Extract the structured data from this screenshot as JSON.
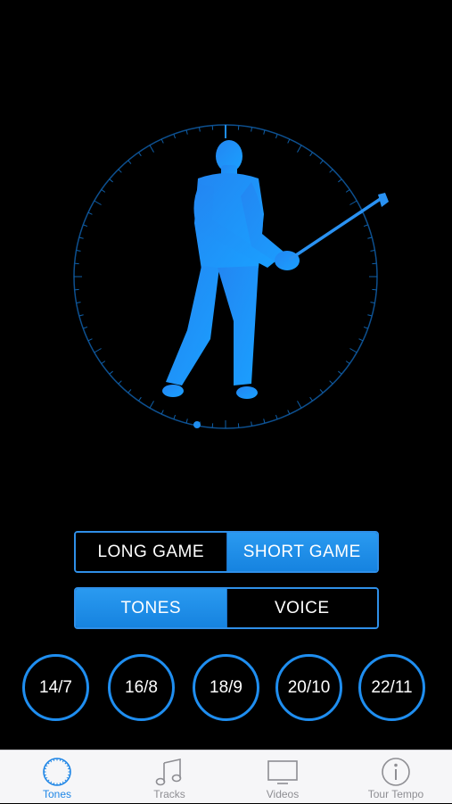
{
  "colors": {
    "accent": "#1f8ef0",
    "background": "#000000",
    "tab_active": "#1f86e6",
    "tab_inactive": "#8e8e93"
  },
  "game_toggle": {
    "options": [
      {
        "label": "LONG GAME",
        "selected": false
      },
      {
        "label": "SHORT GAME",
        "selected": true
      }
    ]
  },
  "sound_toggle": {
    "options": [
      {
        "label": "TONES",
        "selected": true
      },
      {
        "label": "VOICE",
        "selected": false
      }
    ]
  },
  "tempos": [
    "14/7",
    "16/8",
    "18/9",
    "20/10",
    "22/11"
  ],
  "tabs": [
    {
      "label": "Tones",
      "icon": "tones-dial-icon",
      "active": true
    },
    {
      "label": "Tracks",
      "icon": "music-note-icon",
      "active": false
    },
    {
      "label": "Videos",
      "icon": "tv-icon",
      "active": false
    },
    {
      "label": "Tour Tempo",
      "icon": "info-icon",
      "active": false
    }
  ]
}
